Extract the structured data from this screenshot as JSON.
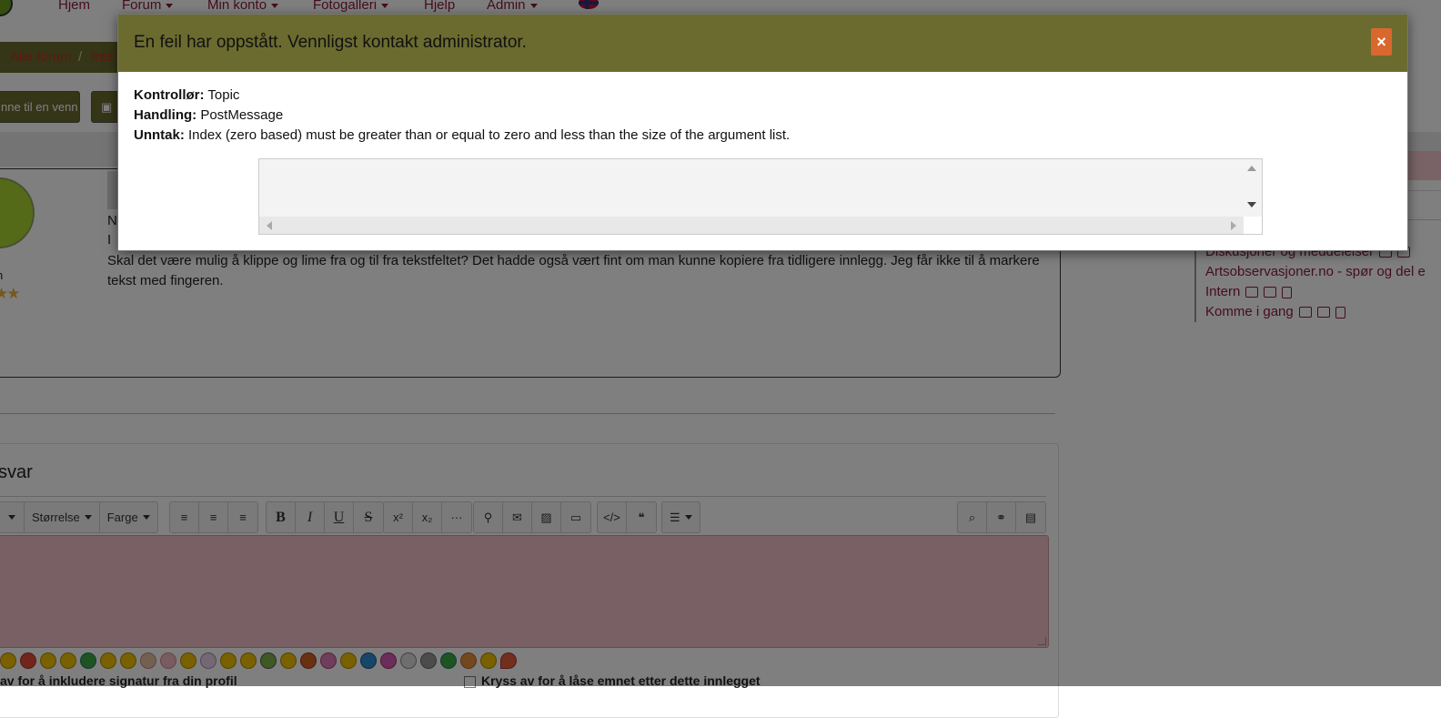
{
  "nav": {
    "items": [
      {
        "label": "Hjem",
        "dropdown": false
      },
      {
        "label": "Forum",
        "dropdown": true
      },
      {
        "label": "Min konto",
        "dropdown": true
      },
      {
        "label": "Fotogalleri",
        "dropdown": true
      },
      {
        "label": "Hjelp",
        "dropdown": false
      },
      {
        "label": "Admin",
        "dropdown": true
      }
    ]
  },
  "breadcrumb": {
    "all_forums": "Alle forum",
    "separator": "/",
    "current_partial": "Inte"
  },
  "actions": {
    "recommend_partial": "nne til en venn",
    "print_icon": "print-icon"
  },
  "post": {
    "author_partial": "n",
    "line1_partial": "N",
    "line2_partial": "I",
    "stars": "★★",
    "text": "Skal det være mulig å klippe og lime fra og til fra tekstfeltet? Det hadde også vært fint om man kunne kopiere fra tidligere innlegg. Jeg får ikke til å markere tekst med fingeren."
  },
  "sidebar": {
    "items": [
      {
        "label": "Diskusjoner og meddelelser"
      },
      {
        "label": "Artsobservasjoner.no - spør og del e"
      },
      {
        "label": "Intern"
      },
      {
        "label": "Komme i gang"
      }
    ]
  },
  "reply": {
    "title_partial": "svar",
    "toolbar": {
      "size_label": "Størrelse",
      "color_label": "Farge",
      "bold": "B",
      "italic": "I",
      "underline": "U",
      "strike": "S",
      "superscript": "x²",
      "subscript": "x₂",
      "more": "···"
    },
    "signature_partial": "av for å inkludere signatur fra din profil",
    "lock_label": "Kryss av for å låse emnet etter dette innlegget"
  },
  "modal": {
    "title": "En feil har oppstått. Vennligst kontakt administrator.",
    "close_label": "×",
    "controller_label": "Kontrollør:",
    "controller_value": "Topic",
    "action_label": "Handling:",
    "action_value": "PostMessage",
    "exception_label": "Unntak:",
    "exception_value": "Index (zero based) must be greater than or equal to zero and less than the size of the argument list."
  },
  "colors": {
    "brand_olive": "#6b6b2f",
    "link": "#8a1c3a",
    "close_button": "#d9682e",
    "editor_bg": "#f0c0c9"
  }
}
